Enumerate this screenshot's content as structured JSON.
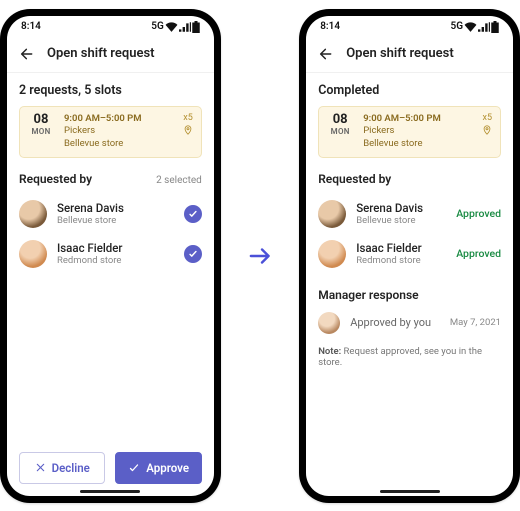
{
  "status": {
    "time": "8:14",
    "net": "5G"
  },
  "header": {
    "title": "Open shift request"
  },
  "shift": {
    "day_num": "08",
    "day_name": "MON",
    "time": "9:00 AM–5:00 PM",
    "role": "Pickers",
    "location": "Bellevue store",
    "slots": "x5"
  },
  "left": {
    "summary": "2 requests, 5 slots",
    "requested_title": "Requested by",
    "selected": "2 selected",
    "people": [
      {
        "name": "Serena Davis",
        "loc": "Bellevue store"
      },
      {
        "name": "Isaac Fielder",
        "loc": "Redmond store"
      }
    ],
    "decline": "Decline",
    "approve": "Approve"
  },
  "right": {
    "summary": "Completed",
    "requested_title": "Requested by",
    "status": "Approved",
    "people": [
      {
        "name": "Serena Davis",
        "loc": "Bellevue store"
      },
      {
        "name": "Isaac Fielder",
        "loc": "Redmond store"
      }
    ],
    "mgr_title": "Manager response",
    "mgr_text": "Approved by you",
    "mgr_date": "May 7, 2021",
    "note_label": "Note:",
    "note_body": "Request approved, see you in the store."
  }
}
